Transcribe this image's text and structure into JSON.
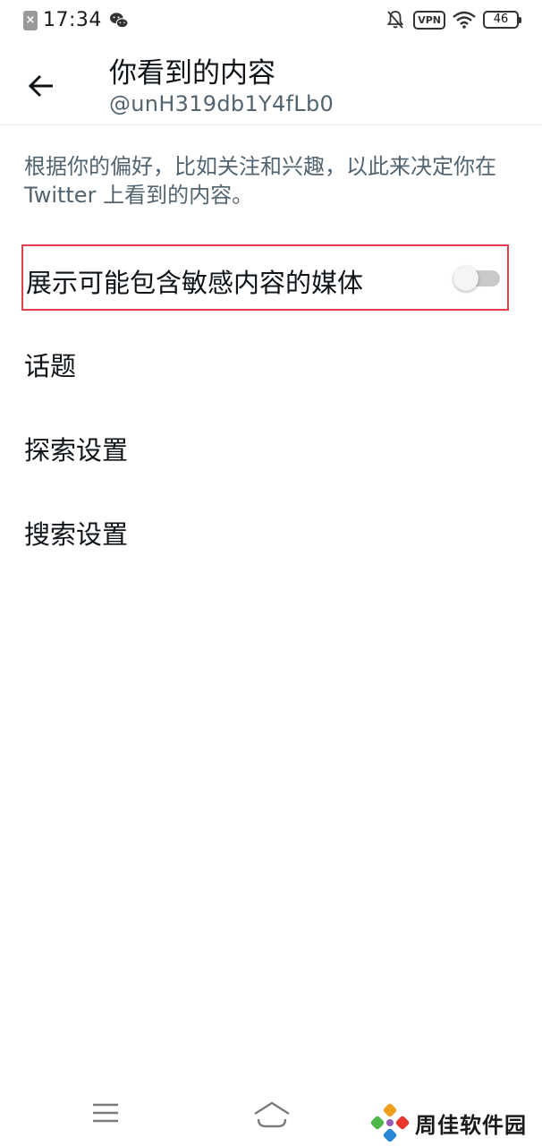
{
  "status_bar": {
    "time": "17:34",
    "vpn": "VPN",
    "battery": "46"
  },
  "header": {
    "title": "你看到的内容",
    "handle": "@unH319db1Y4fLb0"
  },
  "description": "根据你的偏好，比如关注和兴趣，以此来决定你在 Twitter 上看到的内容。",
  "sensitive_media": {
    "label": "展示可能包含敏感内容的媒体",
    "enabled": false
  },
  "items": [
    {
      "label": "话题"
    },
    {
      "label": "探索设置"
    },
    {
      "label": "搜索设置"
    }
  ],
  "watermark": {
    "text": "周佳软件园"
  },
  "colors": {
    "highlight_border": "#e2414b",
    "secondary_text": "#536471",
    "primary_text": "#0f1419"
  }
}
